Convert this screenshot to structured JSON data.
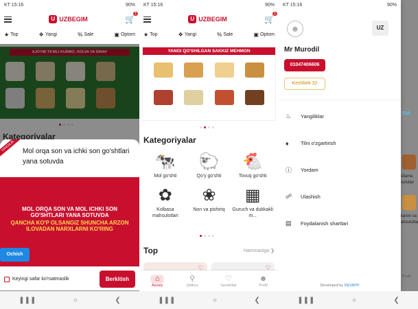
{
  "screen1": {
    "status_time": "KT 15:16",
    "status_right": "90%",
    "logo_text": "UZBEGIM",
    "cart_count": "1",
    "chips": [
      {
        "label": "Top",
        "icon": "star-icon"
      },
      {
        "label": "Yangi",
        "icon": "badge-icon"
      },
      {
        "label": "Sale",
        "icon": "percent-icon"
      },
      {
        "label": "Optom",
        "icon": "box-icon"
      }
    ],
    "banner_text": "AJOYIB TA'MLI KURMO, XOLVA VA DINAY",
    "behind_title": "Kategoriyalar",
    "modal": {
      "ribbon": "YANGILIK",
      "title": "Mol orqa son va ichki son go'shtlari yana sotuvda",
      "banner_line1": "MOL ORQA SON VA MOL ICHKI SON",
      "banner_line2": "GO'SHTLARI YANA SOTUVDA",
      "banner_line3": "QANCHA KO'P OLSANGIZ SHUNCHA ARZON",
      "banner_line4": "ILOVADAN NARXLARNI KO'RING",
      "open_button": "Ochish",
      "checkbox_label": "Keyingi safar ko'rsatmaslik",
      "close_button": "Berkitish"
    }
  },
  "screen2": {
    "status_time": "KT 15:16",
    "status_right": "90%",
    "logo_text": "UZBEGIM",
    "cart_count": "1",
    "chips": [
      {
        "label": "Top"
      },
      {
        "label": "Yangi"
      },
      {
        "label": "Sale"
      },
      {
        "label": "Optom"
      }
    ],
    "banner_title": "YANGI QO'SHILGAN SAKKIZ MEHMON",
    "categories_title": "Kategoriyalar",
    "categories": [
      {
        "label": "Mol go'shti",
        "icon": "cow-icon"
      },
      {
        "label": "Qo'y go'shti",
        "icon": "sheep-icon"
      },
      {
        "label": "Tovuq go'shti",
        "icon": "chicken-icon"
      },
      {
        "label": "Kolbasa mahsulotlari",
        "icon": "sausage-icon"
      },
      {
        "label": "Non va pishiriq",
        "icon": "bread-icon"
      },
      {
        "label": "Guruch va dukkakli m...",
        "icon": "rice-icon"
      }
    ],
    "top_title": "Top",
    "see_all": "Hammasiga",
    "tabs": [
      {
        "label": "Asosiy",
        "icon": "home-icon"
      },
      {
        "label": "Qidiruv",
        "icon": "search-icon"
      },
      {
        "label": "Sevimlilar",
        "icon": "heart-icon"
      },
      {
        "label": "Profil",
        "icon": "user-icon"
      }
    ]
  },
  "screen3": {
    "status_time": "KT 15:16",
    "status_right": "90%",
    "lang": "UZ",
    "user_name": "Mr Murodil",
    "phone": "01047406606",
    "cashback": "Keshbek 32",
    "menu": [
      {
        "label": "Yangiliklar",
        "icon": "bell-icon"
      },
      {
        "label": "Tilni o'zgartirish",
        "icon": "translate-icon"
      },
      {
        "label": "Yordam",
        "icon": "help-icon"
      },
      {
        "label": "Ulashish",
        "icon": "share-icon"
      },
      {
        "label": "Foydalanish shartlari",
        "icon": "document-icon"
      }
    ],
    "developed_by_prefix": "Developed by",
    "developed_by_name": "DEVAPP",
    "peek_labels": [
      "IDA",
      "izlama",
      "sulotlar",
      "karon va",
      "ahsulotlar",
      "Profil"
    ]
  }
}
